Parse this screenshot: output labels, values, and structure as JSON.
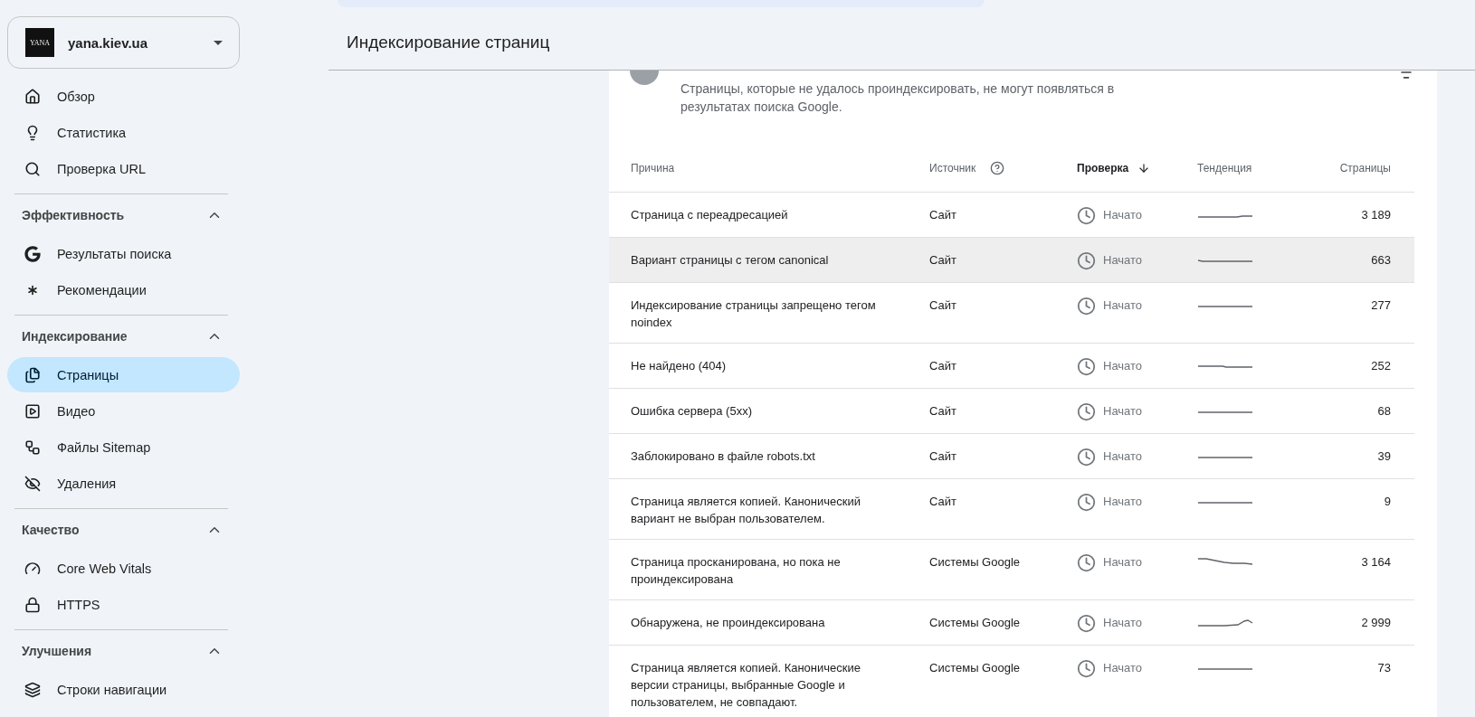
{
  "property": {
    "logo_text": "YANA",
    "name": "yana.kiev.ua"
  },
  "sidebar": {
    "groups": [
      {
        "items": [
          {
            "label": "Обзор",
            "selected": false
          },
          {
            "label": "Статистика",
            "selected": false
          },
          {
            "label": "Проверка URL",
            "selected": false
          }
        ]
      },
      {
        "title": "Эффективность",
        "expanded": true,
        "items": [
          {
            "label": "Результаты поиска",
            "selected": false
          },
          {
            "label": "Рекомендации",
            "selected": false
          }
        ]
      },
      {
        "title": "Индексирование",
        "expanded": true,
        "items": [
          {
            "label": "Страницы",
            "selected": true
          },
          {
            "label": "Видео",
            "selected": false
          },
          {
            "label": "Файлы Sitemap",
            "selected": false
          },
          {
            "label": "Удаления",
            "selected": false
          }
        ]
      },
      {
        "title": "Качество",
        "expanded": true,
        "items": [
          {
            "label": "Core Web Vitals",
            "selected": false
          },
          {
            "label": "HTTPS",
            "selected": false
          }
        ]
      },
      {
        "title": "Улучшения",
        "expanded": true,
        "items": [
          {
            "label": "Строки навигации",
            "selected": false
          }
        ]
      }
    ]
  },
  "page_title": "Индексирование страниц",
  "card": {
    "description": "Страницы, которые не удалось проиндексировать, не могут появляться в результатах поиска Google.",
    "table": {
      "columns": [
        {
          "label": "Причина",
          "sorted": false
        },
        {
          "label": "Источник",
          "sorted": false,
          "help": true
        },
        {
          "label": "Проверка",
          "sorted": true
        },
        {
          "label": "Тенденция",
          "sorted": false
        },
        {
          "label": "Страницы",
          "sorted": false
        }
      ],
      "rows": [
        {
          "reason": "Страница с переадресацией",
          "source": "Сайт",
          "status": "Начато",
          "pages": "3 189",
          "highlighted": false
        },
        {
          "reason": "Вариант страницы с тегом canonical",
          "source": "Сайт",
          "status": "Начато",
          "pages": "663",
          "highlighted": true
        },
        {
          "reason": "Индексирование страницы запрещено тегом noindex",
          "source": "Сайт",
          "status": "Начато",
          "pages": "277",
          "highlighted": false
        },
        {
          "reason": "Не найдено (404)",
          "source": "Сайт",
          "status": "Начато",
          "pages": "252",
          "highlighted": false
        },
        {
          "reason": "Ошибка сервера (5xx)",
          "source": "Сайт",
          "status": "Начато",
          "pages": "68",
          "highlighted": false
        },
        {
          "reason": "Заблокировано в файле robots.txt",
          "source": "Сайт",
          "status": "Начато",
          "pages": "39",
          "highlighted": false
        },
        {
          "reason": "Страница является копией. Канонический вариант не выбран пользователем.",
          "source": "Сайт",
          "status": "Начато",
          "pages": "9",
          "highlighted": false
        },
        {
          "reason": "Страница просканирована, но пока не проиндексирована",
          "source": "Системы Google",
          "status": "Начато",
          "pages": "3 164",
          "highlighted": false
        },
        {
          "reason": "Обнаружена, не проиндексирована",
          "source": "Системы Google",
          "status": "Начато",
          "pages": "2 999",
          "highlighted": false
        },
        {
          "reason": "Страница является копией. Канонические версии страницы, выбранные Google и пользователем, не совпадают.",
          "source": "Системы Google",
          "status": "Начато",
          "pages": "73",
          "highlighted": false
        }
      ]
    }
  }
}
